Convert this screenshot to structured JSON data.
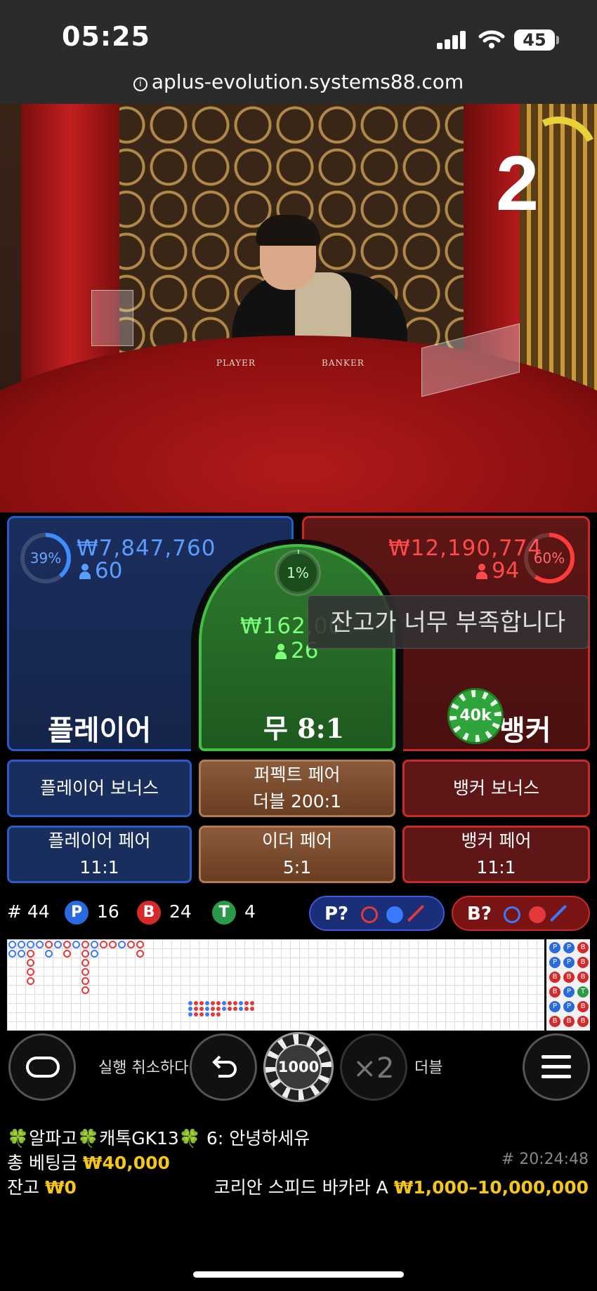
{
  "status_bar": {
    "time": "05:25",
    "battery": "45"
  },
  "browser": {
    "url": "aplus-evolution.systems88.com"
  },
  "video": {
    "round_count": "2",
    "table_labels": [
      "PLAYER",
      "BANKER"
    ]
  },
  "bets": {
    "player": {
      "percent": "39%",
      "amount": "₩7,847,760",
      "players": "60",
      "label": "플레이어",
      "color": "#2a5cc8"
    },
    "tie": {
      "percent": "1%",
      "amount": "₩162,00",
      "players": "26",
      "label": "무",
      "payout": "8:1",
      "color": "#43c043"
    },
    "banker": {
      "percent": "60%",
      "amount": "₩12,190,774",
      "players": "94",
      "label": "뱅커",
      "chip": "40k",
      "color": "#c82a2a"
    }
  },
  "toast": "잔고가 너무 부족합니다",
  "side_bets": {
    "player_bonus": "플레이어 보너스",
    "perfect_pair": "퍼펙트 페어",
    "perfect_pair_payout": "더블 200:1",
    "banker_bonus": "뱅커 보너스",
    "player_pair": "플레이어 페어",
    "player_pair_payout": "11:1",
    "either_pair": "이더 페어",
    "either_pair_payout": "5:1",
    "banker_pair": "뱅커 페어",
    "banker_pair_payout": "11:1"
  },
  "stats": {
    "round_no": "# 44",
    "p_label": "P",
    "p_count": "16",
    "b_label": "B",
    "b_count": "24",
    "t_label": "T",
    "t_count": "4",
    "predict_p": "P?",
    "predict_b": "B?"
  },
  "controls": {
    "undo_label": "실행 취소하다",
    "chip_value": "1000",
    "double_symbol": "×2",
    "double_label": "더블"
  },
  "footer": {
    "chat": "🍀알파고🍀캐톡GK13🍀 6:",
    "chat_msg": "안녕하세유",
    "total_bet_label": "총 베팅금",
    "total_bet": "₩40,000",
    "round_id": "# 20:24:48",
    "balance_label": "잔고",
    "balance": "₩0",
    "table_name": "코리안 스피드 바카라 A",
    "limits": "₩1,000–10,000,000"
  },
  "side_road": [
    "P",
    "P",
    "B",
    "P",
    "P",
    "B",
    "B",
    "B",
    "B",
    "B",
    "P",
    "T",
    "P",
    "P",
    "B",
    "B",
    "B",
    "B"
  ]
}
